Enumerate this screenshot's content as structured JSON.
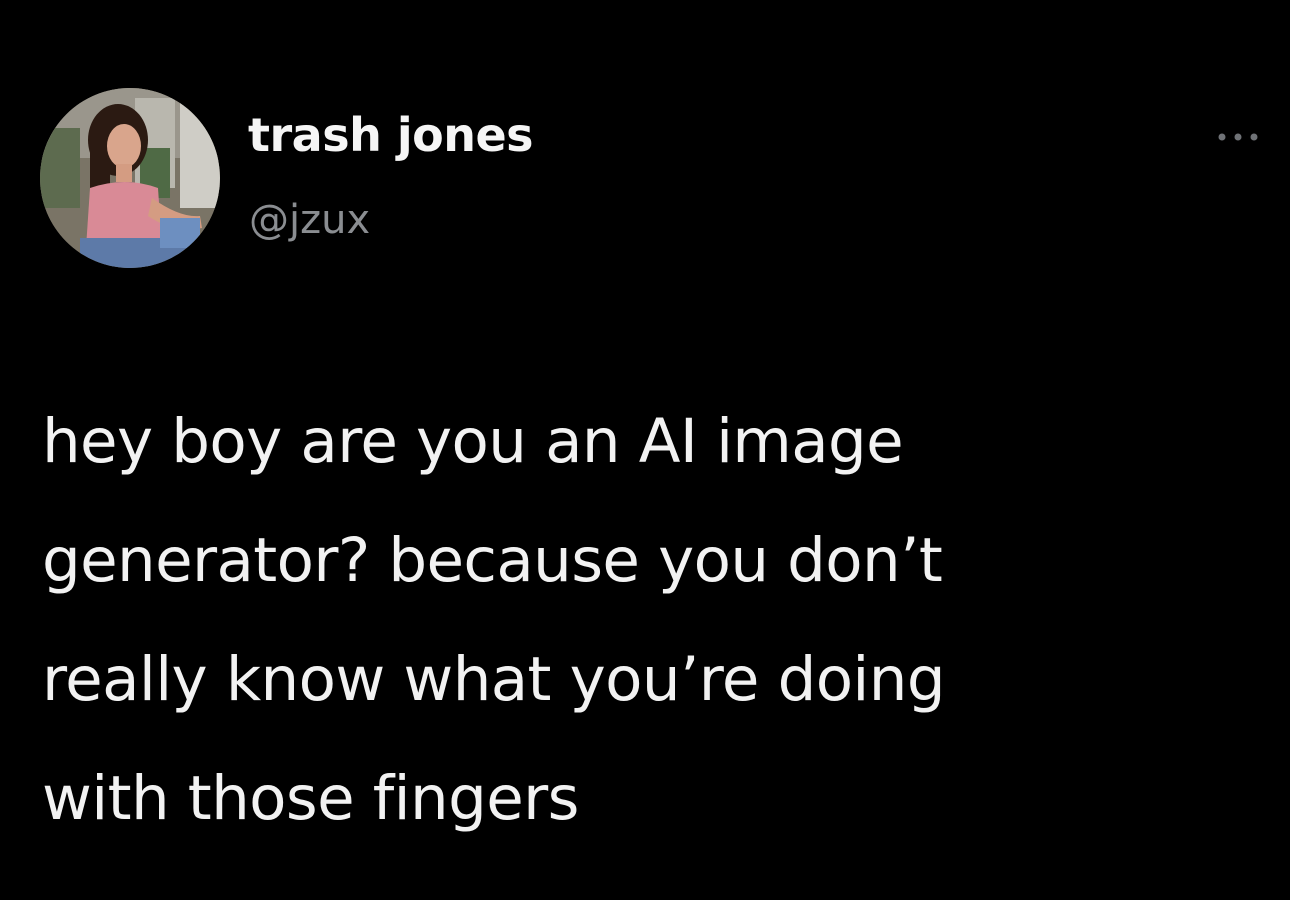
{
  "tweet": {
    "author": {
      "display_name": "trash jones",
      "handle": "@jzux"
    },
    "more_icon": "more-horizontal-icon",
    "text_lines": [
      "hey boy are you an AI image",
      "generator? because you don’t",
      "really know what you’re doing",
      "with those fingers"
    ]
  },
  "colors": {
    "background": "#000000",
    "name_text": "#f5f5f5",
    "handle_text": "#8a8d91",
    "body_text": "#f2f2f2"
  }
}
